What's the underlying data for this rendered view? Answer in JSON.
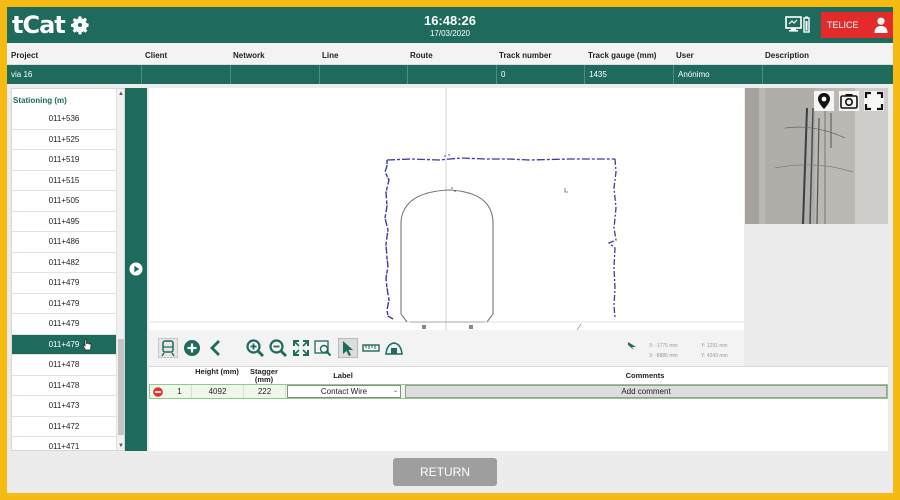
{
  "header": {
    "logo_text": "tCat",
    "time": "16:48:26",
    "date": "17/03/2020",
    "user": "TELICE",
    "brand_color": "#1e6a5d",
    "user_color": "#e42b2b"
  },
  "info_table": {
    "headers": [
      "Project",
      "Client",
      "Network",
      "Line",
      "Route",
      "Track number",
      "Track gauge (mm)",
      "User",
      "Description"
    ],
    "values": [
      "via 16",
      "",
      "",
      "",
      "",
      "0",
      "1435",
      "Anónimo",
      ""
    ]
  },
  "stationing": {
    "title": "Stationing (m)",
    "items": [
      "011+536",
      "011+525",
      "011+519",
      "011+515",
      "011+505",
      "011+495",
      "011+486",
      "011+482",
      "011+479",
      "011+479",
      "011+479",
      "011+479",
      "011+478",
      "011+478",
      "011+473",
      "011+472",
      "011+471"
    ],
    "selected_index": 11
  },
  "toolbar": {
    "icons": [
      "train-icon",
      "add-icon",
      "back-icon",
      "zoom-in-icon",
      "zoom-out-icon",
      "fit-icon",
      "zoom-window-icon",
      "select-cursor-icon",
      "ruler-icon",
      "measure-icon"
    ]
  },
  "coords": {
    "x1_label": "X:",
    "x1_value": "-1775",
    "x1_unit": "mm",
    "y1_label": "Y:",
    "y1_value": "1291",
    "y1_unit": "mm",
    "x2_label": "X:",
    "x2_value": "-8885",
    "x2_unit": "mm",
    "y2_label": "Y:",
    "y2_value": "4243",
    "y2_unit": "mm"
  },
  "results": {
    "headers": {
      "height": "Height (mm)",
      "stagger": "Stagger (mm)",
      "label": "Label",
      "comments": "Comments"
    },
    "rows": [
      {
        "index": "1",
        "height": "4092",
        "stagger": "222",
        "label": "Contact Wire",
        "comment_button": "Add comment"
      }
    ]
  },
  "footer": {
    "return_label": "RETURN"
  }
}
